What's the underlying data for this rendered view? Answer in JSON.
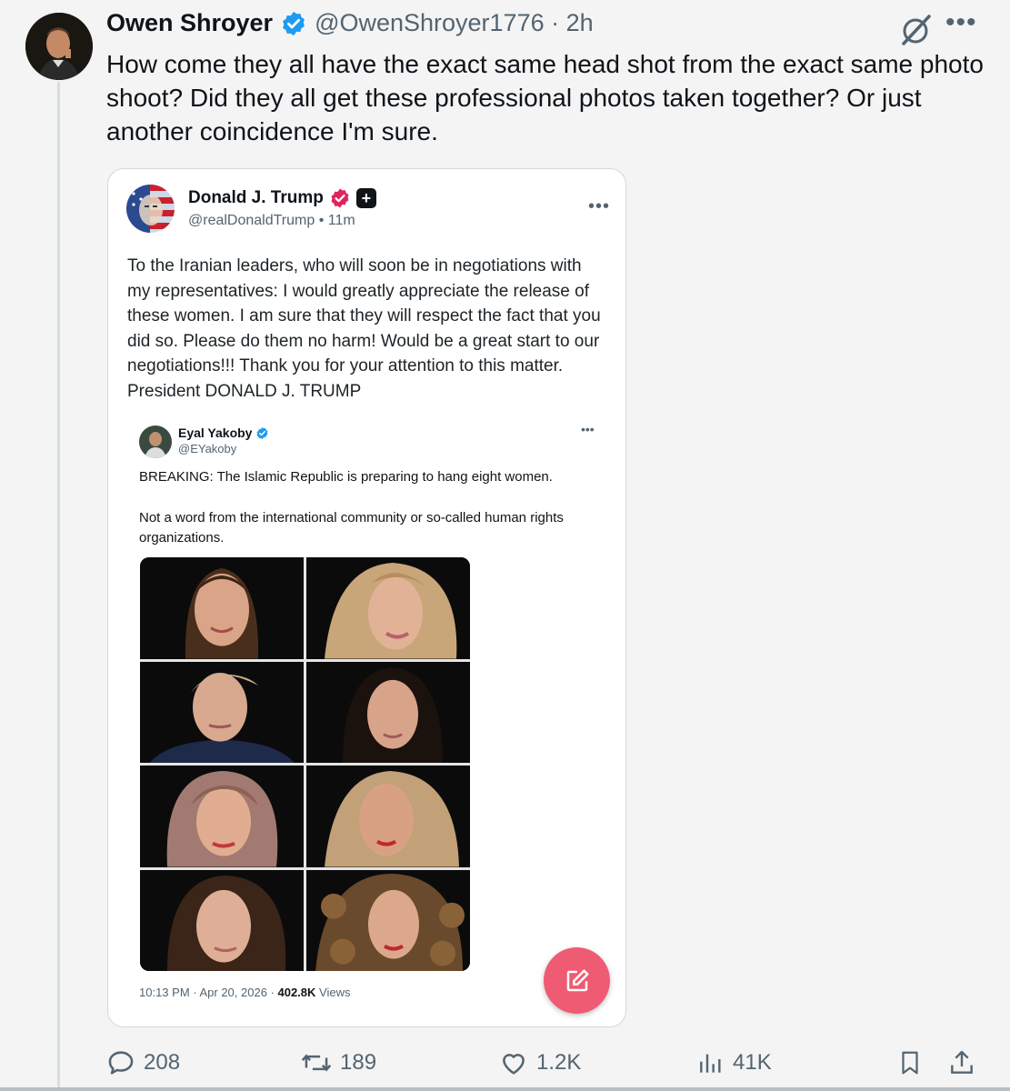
{
  "post": {
    "author_name": "Owen Shroyer",
    "handle_time": "@OwenShroyer1776 · 2h",
    "text": "How come they all have the exact same head shot from the exact same photo shoot? Did they all get these professional photos taken together? Or just another coincidence I'm sure.",
    "more_label": "•••"
  },
  "quoted": {
    "author_name": "Donald J. Trump",
    "handle_time": "@realDonaldTrump • 11m",
    "plus_label": "+",
    "more_label": "•••",
    "text": "To the Iranian leaders, who will soon be in negotiations with my representatives: I would greatly appreciate the release of these women. I am sure that they will respect the fact that you did so. Please do them no harm! Would be a great start to our negotiations!!! Thank you for your attention to this matter. President DONALD J. TRUMP",
    "embedded": {
      "author_name": "Eyal Yakoby",
      "handle": "@EYakoby",
      "more_label": "•••",
      "text_1": "BREAKING: The Islamic Republic is preparing to hang eight women.",
      "text_2": "Not a word from the international community or so-called human rights organizations.",
      "timestamp": "10:13 PM · Apr 20, 2026 · ",
      "views_count": "402.8K",
      "views_label": " Views"
    }
  },
  "actions": {
    "replies": "208",
    "reposts": "189",
    "likes": "1.2K",
    "views": "41K"
  },
  "colors": {
    "verified_blue": "#1d9bf0",
    "verified_red": "#e0245e",
    "fab_pink": "#ef5b72",
    "muted_text": "#536471"
  }
}
